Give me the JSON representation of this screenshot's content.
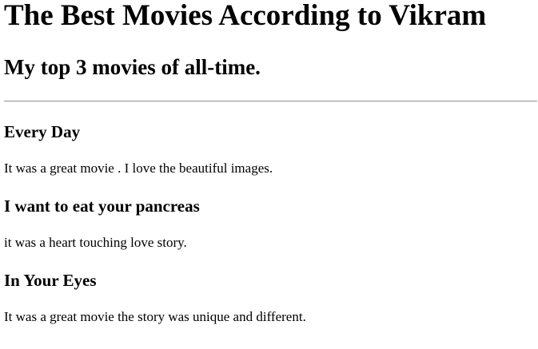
{
  "page": {
    "title": "The Best Movies According to Vikram",
    "subtitle": "My top 3 movies of all-time."
  },
  "movies": [
    {
      "title": "Every Day",
      "review": "It was a great movie . I love the beautiful images."
    },
    {
      "title": "I want to eat your pancreas",
      "review": "it was a heart touching love story."
    },
    {
      "title": "In Your Eyes",
      "review": "It was a great movie the story was unique and different."
    }
  ]
}
